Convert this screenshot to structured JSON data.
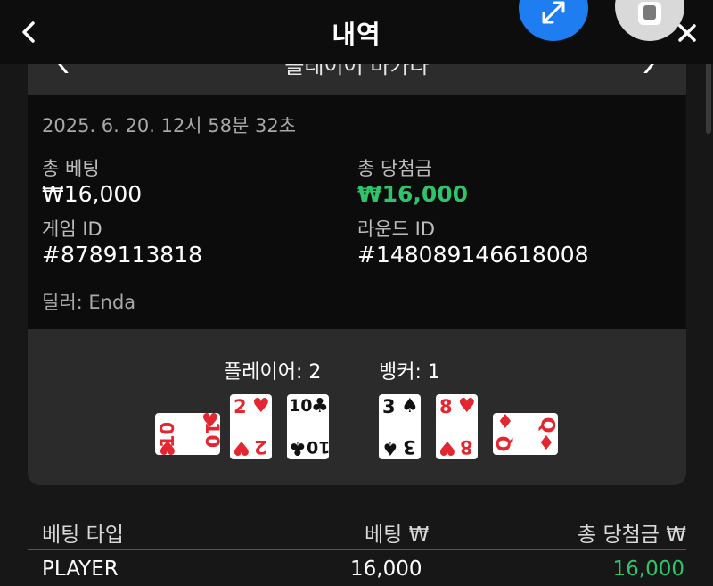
{
  "header": {
    "title": "내역",
    "back_icon": "chevron-left-icon",
    "expand_icon": "expand-arrows-icon",
    "stop_icon": "stop-square-icon",
    "close_icon": "close-icon"
  },
  "round_nav": {
    "label": "플레이어 바카라",
    "prev_icon": "chevron-left-icon",
    "next_icon": "chevron-right-icon"
  },
  "details": {
    "datetime": "2025. 6. 20. 12시 58분 32초",
    "total_bet_label": "총 베팅",
    "total_bet_value": "₩16,000",
    "total_win_label": "총 당첨금",
    "total_win_value": "₩16,000",
    "game_id_label": "게임 ID",
    "game_id_value": "#8789113818",
    "round_id_label": "라운드 ID",
    "round_id_value": "#148089146618008",
    "dealer": "딜러: Enda"
  },
  "result": {
    "player_score": "플레이어: 2",
    "banker_score": "뱅커: 1",
    "player_cards": [
      {
        "rank": "10",
        "suit": "♥",
        "color": "red",
        "orientation": "sideways"
      },
      {
        "rank": "2",
        "suit": "♥",
        "color": "red",
        "orientation": "upright"
      },
      {
        "rank": "10",
        "suit": "♣",
        "color": "black",
        "orientation": "upright"
      }
    ],
    "banker_cards": [
      {
        "rank": "3",
        "suit": "♠",
        "color": "black",
        "orientation": "upright"
      },
      {
        "rank": "8",
        "suit": "♥",
        "color": "red",
        "orientation": "upright"
      },
      {
        "rank": "Q",
        "suit": "♦",
        "color": "red",
        "orientation": "sideways"
      }
    ]
  },
  "bets_table": {
    "headers": [
      "베팅 타입",
      "베팅 ₩",
      "총 당첨금 ₩"
    ],
    "rows": [
      {
        "type": "PLAYER",
        "bet": "16,000",
        "win": "16,000"
      }
    ]
  },
  "colors": {
    "accent_blue": "#1e7df0",
    "win_green": "#2fc46a",
    "card_red": "#e3262f",
    "background": "#171717"
  }
}
